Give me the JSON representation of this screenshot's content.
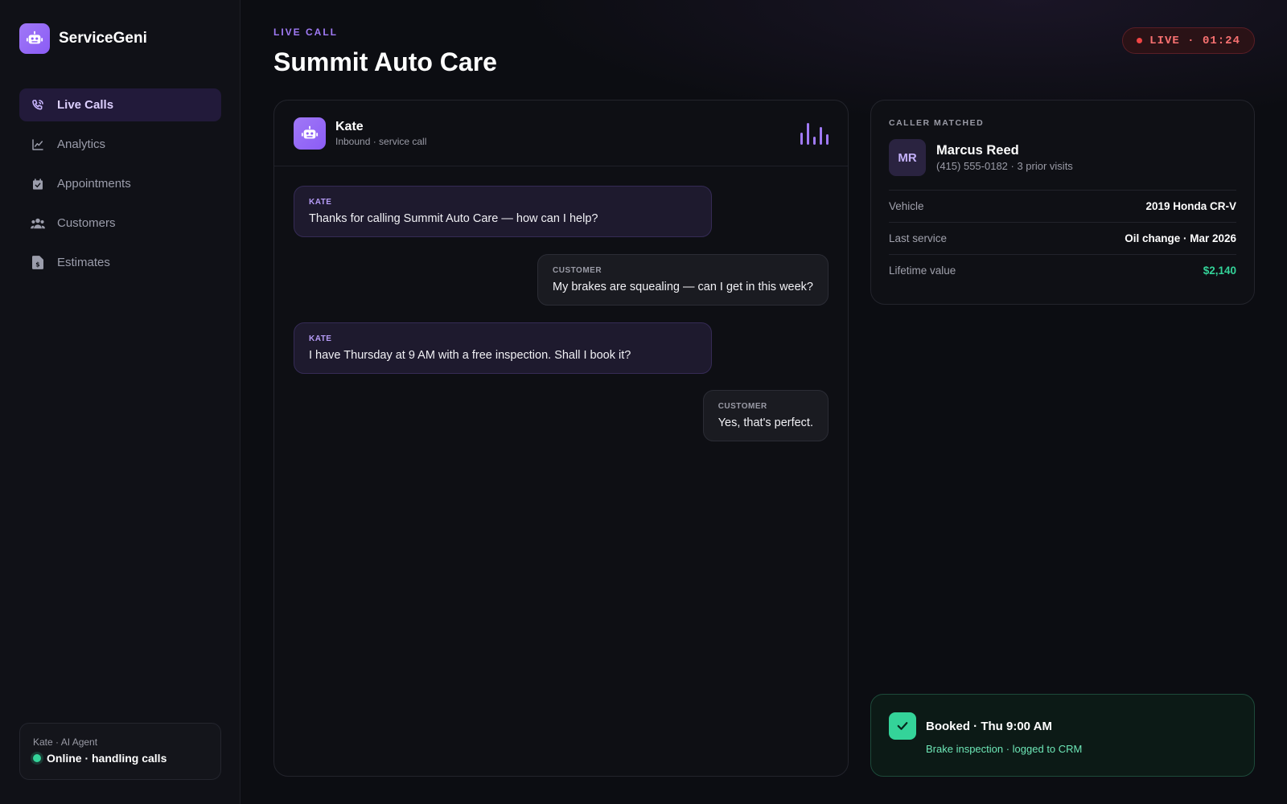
{
  "brand": {
    "name": "ServiceGeni",
    "icon": "robot-icon"
  },
  "nav": {
    "items": [
      {
        "label": "Live Calls",
        "icon": "phone-icon",
        "active": true
      },
      {
        "label": "Analytics",
        "icon": "line-chart-icon",
        "active": false
      },
      {
        "label": "Appointments",
        "icon": "calendar-check-icon",
        "active": false
      },
      {
        "label": "Customers",
        "icon": "users-icon",
        "active": false
      },
      {
        "label": "Estimates",
        "icon": "invoice-icon",
        "active": false
      }
    ]
  },
  "agent_card": {
    "label": "Kate · AI Agent",
    "status": "Online · handling calls"
  },
  "header": {
    "eyebrow": "LIVE CALL",
    "title": "Summit Auto Care",
    "live_status": "LIVE · 01:24"
  },
  "call": {
    "agent_name": "Kate",
    "subtitle": "Inbound · service call",
    "messages": [
      {
        "role": "KATE",
        "text": "Thanks for calling Summit Auto Care — how can I help?",
        "type": "agent"
      },
      {
        "role": "CUSTOMER",
        "text": "My brakes are squealing — can I get in this week?",
        "type": "customer"
      },
      {
        "role": "KATE",
        "text": "I have Thursday at 9 AM with a free inspection. Shall I book it?",
        "type": "agent"
      },
      {
        "role": "CUSTOMER",
        "text": "Yes, that's perfect.",
        "type": "customer"
      }
    ]
  },
  "caller": {
    "eyebrow": "CALLER MATCHED",
    "initials": "MR",
    "name": "Marcus Reed",
    "subtitle": "(415) 555-0182 · 3 prior visits",
    "details": [
      {
        "label": "Vehicle",
        "value": "2019 Honda CR-V"
      },
      {
        "label": "Last service",
        "value": "Oil change · Mar 2026"
      },
      {
        "label": "Lifetime value",
        "value": "$2,140"
      }
    ]
  },
  "booking": {
    "title": "Booked · Thu 9:00 AM",
    "subtitle": "Brake inspection · logged to CRM"
  },
  "colors": {
    "accent": "#8b5cf6",
    "live": "#ef4444",
    "success": "#34d399"
  }
}
